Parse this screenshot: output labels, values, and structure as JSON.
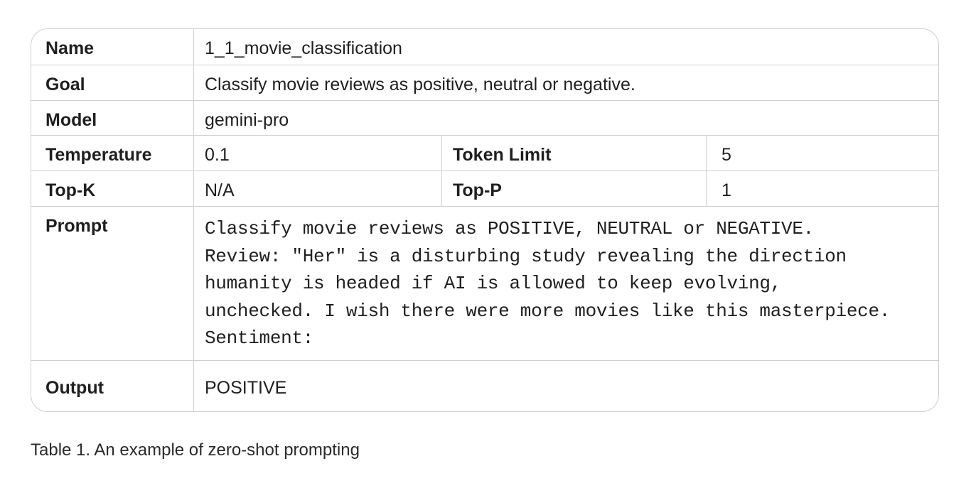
{
  "table": {
    "name_label": "Name",
    "name_value": "1_1_movie_classification",
    "goal_label": "Goal",
    "goal_value": "Classify movie reviews as positive, neutral or negative.",
    "model_label": "Model",
    "model_value": "gemini-pro",
    "temperature_label": "Temperature",
    "temperature_value": "0.1",
    "token_limit_label": "Token Limit",
    "token_limit_value": "5",
    "topk_label": "Top-K",
    "topk_value": "N/A",
    "topp_label": "Top-P",
    "topp_value": "1",
    "prompt_label": "Prompt",
    "prompt_lines": [
      "Classify movie reviews as POSITIVE, NEUTRAL or NEGATIVE.",
      "Review: \"Her\" is a disturbing study revealing the direction",
      "humanity is headed if AI is allowed to keep evolving,",
      "unchecked. I wish there were more movies like this masterpiece.",
      "Sentiment:"
    ],
    "output_label": "Output",
    "output_value": "POSITIVE"
  },
  "caption": "Table 1. An example of zero-shot prompting"
}
